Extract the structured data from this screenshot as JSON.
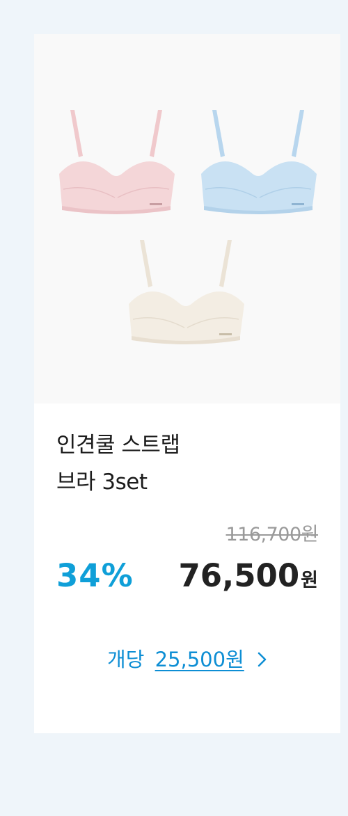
{
  "product": {
    "title_line1": "인견쿨 스트랩",
    "title_line2": "브라 3set",
    "image_alt": "Pink, sky blue and ivory strap bras",
    "colors": {
      "pink": "#f4d6d8",
      "blue": "#c9e1f3",
      "ivory": "#f3ede3"
    }
  },
  "pricing": {
    "original_price": "116,700원",
    "discount_rate": "34%",
    "sale_amount": "76,500",
    "sale_unit": "원",
    "per_unit_prefix": "개당",
    "per_unit_price": "25,500원",
    "per_unit_icon": "chevron-right-icon"
  },
  "theme": {
    "accent": "#0f9fd8",
    "background": "#eff5fa"
  }
}
